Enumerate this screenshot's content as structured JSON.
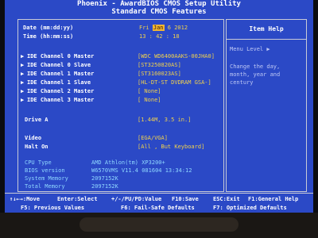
{
  "header": {
    "title": "Phoenix - AwardBIOS CMOS Setup Utility",
    "subtitle": "Standard CMOS Features"
  },
  "datetime": {
    "date_label": "Date (mm:dd:yy)",
    "time_label": "Time (hh:mm:ss)",
    "day": "Fri",
    "month": "Jan",
    "day_num": "6",
    "year": "2012",
    "time": "13 : 42 : 18"
  },
  "ide_channels": [
    {
      "label": "IDE Channel 0 Master",
      "value": "[WDC WD6400AAKS-00JHA0]"
    },
    {
      "label": "IDE Channel 0 Slave",
      "value": "[ST3250820AS]"
    },
    {
      "label": "IDE Channel 1 Master",
      "value": "[ST3160023AS]"
    },
    {
      "label": "IDE Channel 1 Slave",
      "value": "[HL-DT-ST DVDRAM GSA-]"
    },
    {
      "label": "IDE Channel 2 Master",
      "value": "[ None]"
    },
    {
      "label": "IDE Channel 3 Master",
      "value": "[ None]"
    }
  ],
  "settings": [
    {
      "label": "Drive A",
      "value": "[1.44M, 3.5 in.]"
    },
    {
      "label": "Video",
      "value": "[EGA/VGA]"
    },
    {
      "label": "Halt On",
      "value": "[All , But Keyboard]"
    }
  ],
  "system_info": [
    {
      "label": "CPU Type",
      "value": "AMD Athlon(tm) XP3200+"
    },
    {
      "label": "BIOS version",
      "value": "W6570VMS V11.4 081604 13:34:12"
    },
    {
      "label": "System Memory",
      "value": "2097152K"
    },
    {
      "label": "Total Memory",
      "value": "2097152K"
    }
  ],
  "help": {
    "title": "Item Help",
    "menu_level": "Menu Level",
    "menu_level_arrow": "▶",
    "description": "Change the day, month, year and century"
  },
  "footer": {
    "row1": [
      {
        "keys": "↑↓←→",
        "text": ":Move"
      },
      {
        "keys": "Enter",
        "text": ":Select"
      },
      {
        "keys": "+/-/PU/PD",
        "text": ":Value"
      },
      {
        "keys": "F10",
        "text": ":Save"
      },
      {
        "keys": "ESC",
        "text": ":Exit"
      },
      {
        "keys": "F1",
        "text": ":General Help"
      }
    ],
    "row2": [
      {
        "keys": "F5",
        "text": ": Previous Values"
      },
      {
        "keys": "F6",
        "text": ": Fail-Safe Defaults"
      },
      {
        "keys": "F7",
        "text": ": Optimized Defaults"
      }
    ]
  },
  "colors": {
    "background": "#2b49c6",
    "highlight": "#f2b632",
    "value_text": "#f1d24d",
    "info_text": "#8fd7ff"
  }
}
